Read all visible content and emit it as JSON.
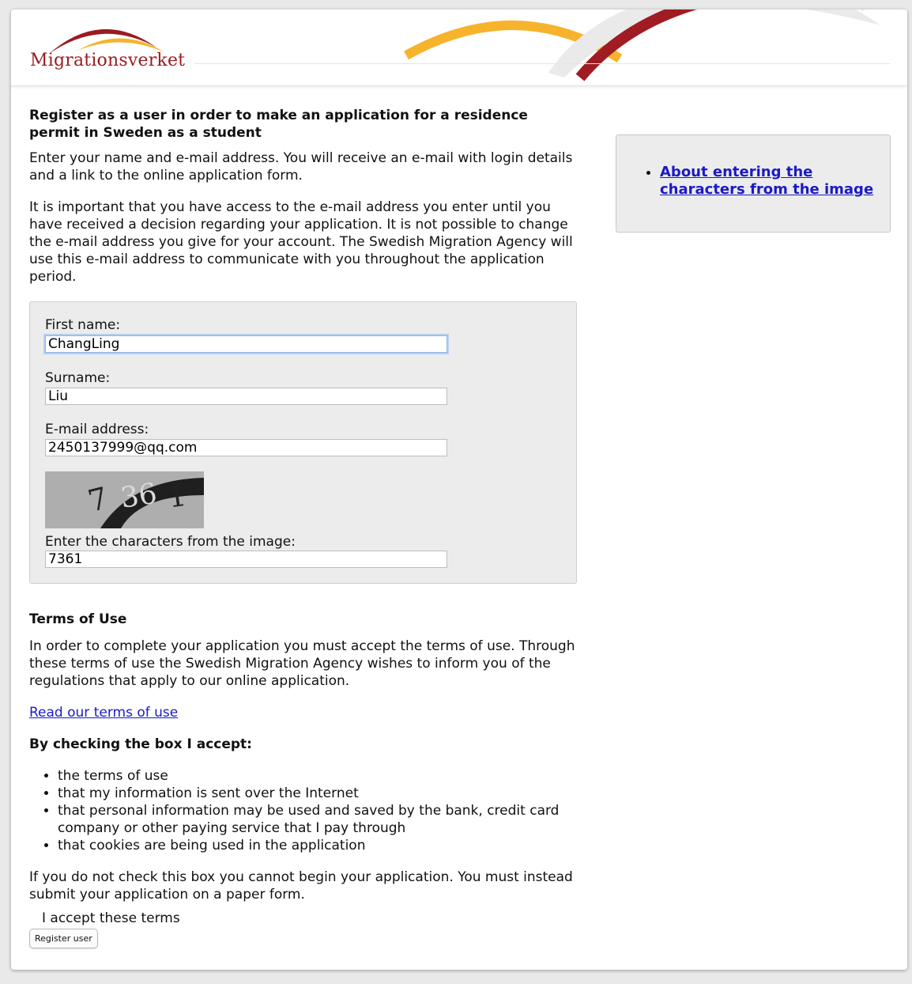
{
  "header": {
    "logo_text": "Migrationsverket",
    "colors": {
      "brand_red": "#9b1b20",
      "accent_orange": "#f7b32b",
      "arc_grey": "#e8e8e8"
    }
  },
  "main": {
    "title": "Register as a user in order to make an application for a residence permit in Sweden as a student",
    "intro": "Enter your name and e-mail address. You will receive an e-mail with login details and a link to the online application form.",
    "important": "It is important that you have access to the e-mail address you enter until you have received a decision regarding your application. It is not possible to change the e-mail address you give for your account. The Swedish Migration Agency will use this e-mail address to communicate with you throughout the application period."
  },
  "form": {
    "first_name_label": "First name:",
    "first_name_value": "ChangLing",
    "surname_label": "Surname:",
    "surname_value": "Liu",
    "email_label": "E-mail address:",
    "email_value": "2450137999@qq.com",
    "captcha_label": "Enter the characters from the image:",
    "captcha_value": "7361",
    "captcha_image_text": "7361"
  },
  "terms": {
    "heading": "Terms of Use",
    "body": "In order to complete your application you must accept the terms of use. Through these terms of use the Swedish Migration Agency wishes to inform you of the regulations that apply to our online application.",
    "link": "Read our terms of use",
    "accept_heading": "By checking the box I accept:",
    "accept_items": [
      "the terms of use",
      "that my information is sent over the Internet",
      "that personal information may be used and saved by the bank, credit card company or other paying service that I pay through",
      "that cookies are being used in the application"
    ],
    "warning": "If you do not check this box you cannot begin your application. You must instead submit your application on a paper form.",
    "accept_label": "I accept these terms",
    "register_button": "Register user"
  },
  "sidebar": {
    "link": "About entering the characters from the image"
  }
}
